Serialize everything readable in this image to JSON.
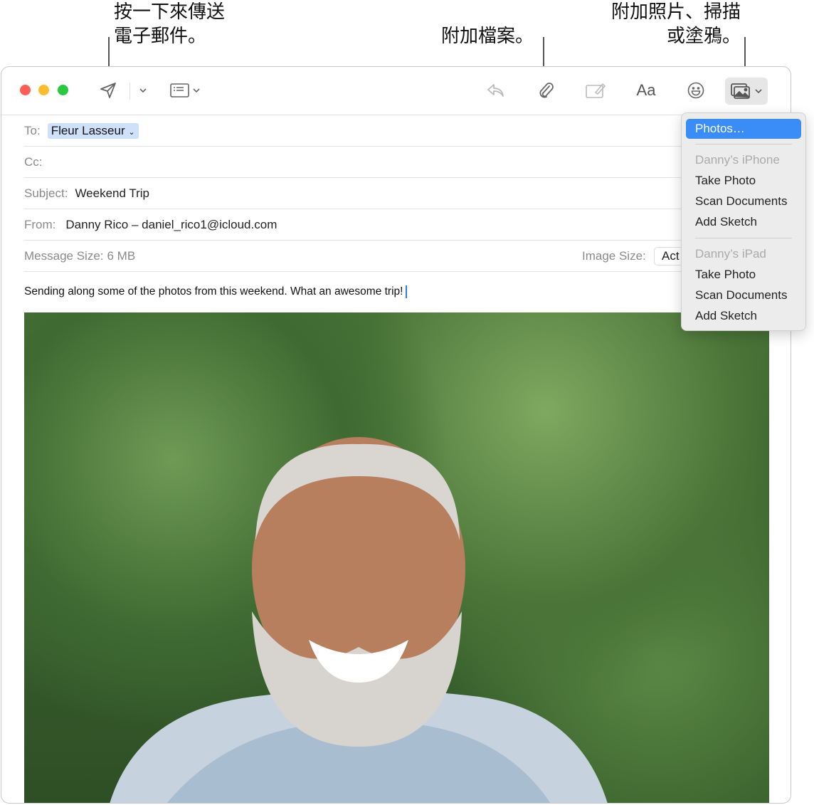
{
  "callouts": {
    "send": [
      "按一下來傳送",
      "電子郵件。"
    ],
    "attach": "附加檔案。",
    "photo": [
      "附加照片、掃描",
      "或塗鴉。"
    ]
  },
  "toolbar": {
    "icons": [
      "send-icon",
      "chevron-down-icon",
      "header-fields-icon",
      "reply-icon",
      "paperclip-icon",
      "markup-icon",
      "font-icon",
      "emoji-icon",
      "photo-browser-icon"
    ],
    "font_label": "Aa"
  },
  "header": {
    "to_label": "To:",
    "to_value": "Fleur Lasseur",
    "cc_label": "Cc:",
    "subject_label": "Subject:",
    "subject_value": "Weekend Trip",
    "from_label": "From:",
    "from_value": "Danny Rico – daniel_rico1@icloud.com",
    "size_label": "Message Size:",
    "size_value": "6 MB",
    "image_size_label": "Image Size:",
    "image_size_value": "Act"
  },
  "body": {
    "text": "Sending along some of the photos from this weekend. What an awesome trip!"
  },
  "menu": {
    "photos": "Photos…",
    "iphone": "Danny’s iPhone",
    "iphone_items": [
      "Take Photo",
      "Scan Documents",
      "Add Sketch"
    ],
    "ipad": "Danny’s iPad",
    "ipad_items": [
      "Take Photo",
      "Scan Documents",
      "Add Sketch"
    ]
  },
  "colors": {
    "accent": "#3a8cf6",
    "close": "#fe5f57",
    "minimize": "#febc2e",
    "zoom": "#28c840"
  }
}
